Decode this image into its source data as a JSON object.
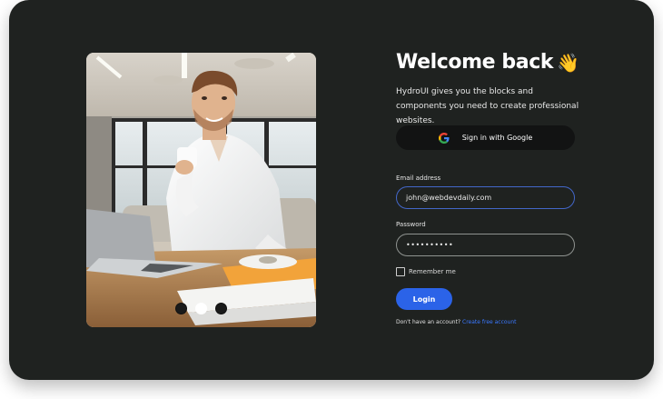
{
  "heading": {
    "title": "Welcome back",
    "wave": "👋"
  },
  "subtitle": "HydroUI gives you the blocks and components you need to create professional websites.",
  "google_button": {
    "label": "Sign in with Google",
    "icon": "google-icon"
  },
  "email": {
    "label": "Email address",
    "value": "john@webdevdaily.com",
    "border_color": "#4367c9"
  },
  "password": {
    "label": "Password",
    "value": "••••••••••"
  },
  "remember": {
    "label": "Remember me",
    "checked": false
  },
  "login_button": {
    "label": "Login",
    "color": "#2b63e8"
  },
  "signup": {
    "prompt": "Don't have an account?",
    "link": "Create free account",
    "link_color": "#3a78ff"
  },
  "carousel": {
    "slides": 3,
    "active_index": 1
  },
  "colors": {
    "background": "#1f2220",
    "google_button_bg": "#121313"
  }
}
